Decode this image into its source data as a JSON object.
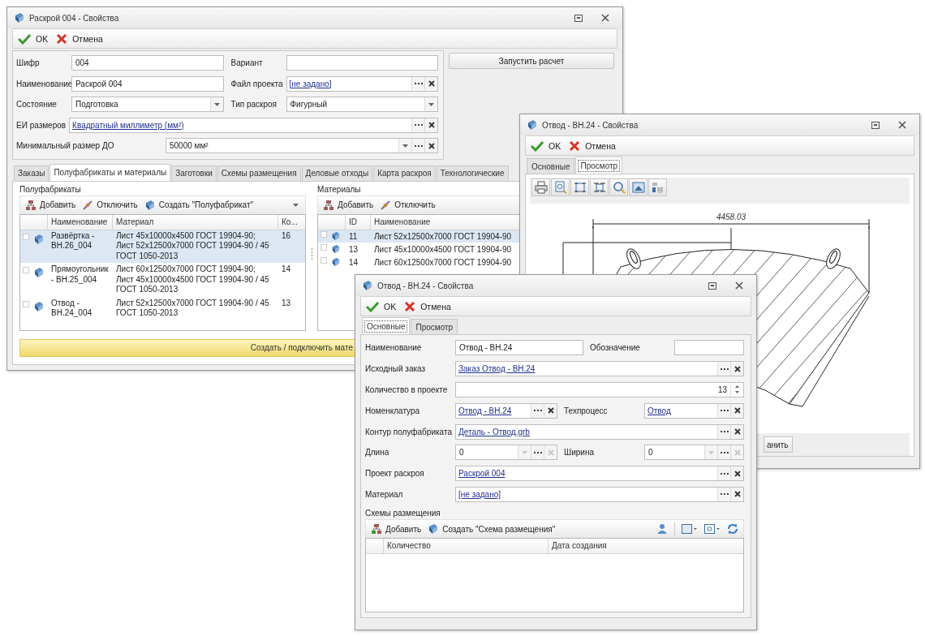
{
  "main_window": {
    "title": "Раскрой 004 - Свойства",
    "actions": [
      {
        "kind": "ok",
        "label": "OK"
      },
      {
        "kind": "cancel",
        "label": "Отмена"
      }
    ],
    "form_rows": [
      {
        "fields": [
          {
            "label": "Шифр",
            "kind": "text",
            "value": "004"
          },
          {
            "label": "Вариант",
            "kind": "text"
          }
        ]
      },
      {
        "fields": [
          {
            "label": "Наименование",
            "kind": "text",
            "value": "Раскрой 004"
          },
          {
            "label": "Файл проекта",
            "kind": "link",
            "value": "[не задано]",
            "picker": true
          }
        ]
      },
      {
        "fields": [
          {
            "label": "Состояние",
            "kind": "text",
            "value": "Подготовка",
            "dropdown": true
          },
          {
            "label": "Тип раскроя",
            "kind": "text",
            "value": "Фигурный",
            "dropdown": true
          }
        ]
      },
      {
        "fields": [
          {
            "label": "ЕИ размеров",
            "kind": "link",
            "value": "Квадратный миллиметр (мм²)",
            "picker": true
          }
        ]
      },
      {
        "fields": [
          {
            "label": "Минимальный размер ДО",
            "kind": "text",
            "value": "50000 мм²",
            "dropdown": true,
            "picker": true
          }
        ]
      }
    ],
    "run_button": "Запустить расчет",
    "tabs": [
      {
        "label": "Заказы",
        "selected": false
      },
      {
        "label": "Полуфабрикаты и материалы",
        "selected": true
      },
      {
        "label": "Заготовки",
        "selected": false
      },
      {
        "label": "Схемы размещения",
        "selected": false
      },
      {
        "label": "Деловые отходы",
        "selected": false
      },
      {
        "label": "Карта раскроя",
        "selected": false
      },
      {
        "label": "Технологические",
        "selected": false
      }
    ],
    "semi_products": {
      "title": "Полуфабрикаты",
      "toolbar": [
        {
          "kind": "add",
          "label": "Добавить"
        },
        {
          "kind": "disconnect",
          "label": "Отключить"
        },
        {
          "kind": "create",
          "label": "Создать \"Полуфабрикат\""
        }
      ],
      "columns": [
        "Наименование",
        "Материал",
        "Ко..."
      ],
      "rows": [
        {
          "name": "Развёртка - ВН.26_004",
          "material": "Лист 45x10000x4500 ГОСТ 19904-90; Лист 52x12500x7000 ГОСТ 19904-90 / 45 ГОСТ 1050-2013",
          "count": "16",
          "selected": true
        },
        {
          "name": "Прямоугольник - ВН.25_004",
          "material": "Лист 60x12500x7000 ГОСТ 19904-90; Лист 45x10000x4500 ГОСТ 19904-90 / 45 ГОСТ 1050-2013",
          "count": "14",
          "selected": false
        },
        {
          "name": "Отвод - ВН.24_004",
          "material": "Лист 52x12500x7000 ГОСТ 19904-90 / 45 ГОСТ 1050-2013",
          "count": "13",
          "selected": false
        }
      ]
    },
    "materials": {
      "title": "Материалы",
      "toolbar": [
        {
          "kind": "add",
          "label": "Добавить"
        },
        {
          "kind": "disconnect",
          "label": "Отключить"
        }
      ],
      "columns": [
        "ID",
        "Наименование"
      ],
      "rows": [
        {
          "id": "11",
          "name": "Лист 52x12500x7000 ГОСТ 19904-90",
          "selected": true
        },
        {
          "id": "13",
          "name": "Лист 45x10000x4500 ГОСТ 19904-90",
          "selected": false
        },
        {
          "id": "14",
          "name": "Лист 60x12500x7000 ГОСТ 19904-90",
          "selected": false
        }
      ]
    },
    "action_bar": "Создать / подключить мате"
  },
  "preview_window": {
    "title": "Отвод - ВН.24 - Свойства",
    "actions": [
      {
        "kind": "ok",
        "label": "OK"
      },
      {
        "kind": "cancel",
        "label": "Отмена"
      }
    ],
    "tabs": [
      {
        "label": "Основные",
        "selected": false
      },
      {
        "label": "Просмотр",
        "selected": true
      }
    ],
    "drawing": {
      "dimension": "4458.03"
    },
    "button": "анить"
  },
  "detail_window": {
    "title": "Отвод - ВН.24 - Свойства",
    "actions": [
      {
        "kind": "ok",
        "label": "OK"
      },
      {
        "kind": "cancel",
        "label": "Отмена"
      }
    ],
    "tabs": [
      {
        "label": "Основные",
        "selected": true
      },
      {
        "label": "Просмотр",
        "selected": false
      }
    ],
    "form_rows": [
      {
        "fields": [
          {
            "label": "Наименование",
            "kind": "text",
            "value": "Отвод - ВН.24"
          },
          {
            "label": "Обозначение",
            "kind": "text"
          }
        ]
      },
      {
        "fields": [
          {
            "label": "Исходный заказ",
            "kind": "link",
            "value": "Заказ Отвод - ВН.24",
            "picker": true
          }
        ]
      },
      {
        "fields": [
          {
            "label": "Количество в проекте",
            "kind": "spin",
            "value": "13"
          }
        ]
      },
      {
        "fields": [
          {
            "label": "Номенклатура",
            "kind": "link",
            "value": "Отвод - ВН.24",
            "picker": true
          },
          {
            "label": "Техпроцесс",
            "kind": "link",
            "value": "Отвод",
            "picker": true
          }
        ]
      },
      {
        "fields": [
          {
            "label": "Контур полуфабриката",
            "kind": "link",
            "value": "Деталь - Отвод.grb",
            "picker": true
          }
        ]
      },
      {
        "fields": [
          {
            "label": "Длина",
            "kind": "text",
            "value": "0",
            "dropdown": true,
            "picker": true,
            "disabled": true
          },
          {
            "label": "Ширина",
            "kind": "text",
            "value": "0",
            "dropdown": true,
            "picker": true,
            "disabled": true
          }
        ]
      },
      {
        "fields": [
          {
            "label": "Проект раскроя",
            "kind": "link",
            "value": "Раскрой 004",
            "picker": true
          }
        ]
      },
      {
        "fields": [
          {
            "label": "Материал",
            "kind": "link",
            "value": "[не задано]",
            "picker": true
          }
        ]
      }
    ],
    "schemes": {
      "title": "Схемы размещения",
      "toolbar": [
        {
          "kind": "add",
          "label": "Добавить"
        },
        {
          "kind": "create",
          "label": "Создать \"Схема размещения\""
        }
      ],
      "columns": [
        "Количество",
        "Дата создания"
      ]
    }
  }
}
